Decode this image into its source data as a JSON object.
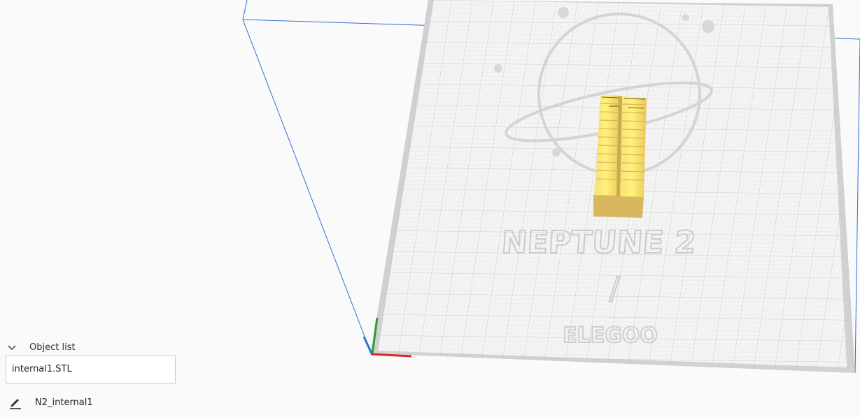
{
  "viewport": {
    "bed_logo_text": "NEPTUNE 2",
    "bed_logo_sub": "/",
    "bed_brand": "ELEGOO",
    "model_color": "#f2d66a",
    "build_volume_color": "#2f6fd6",
    "axis_x_color": "#d62828",
    "axis_y_color": "#2a9d2a",
    "axis_z_color": "#2f6fd6"
  },
  "object_list": {
    "title": "Object list",
    "items": [
      {
        "label": "internal1.STL"
      }
    ]
  },
  "job": {
    "name": "N2_internal1",
    "edit_icon": "pencil-icon"
  }
}
